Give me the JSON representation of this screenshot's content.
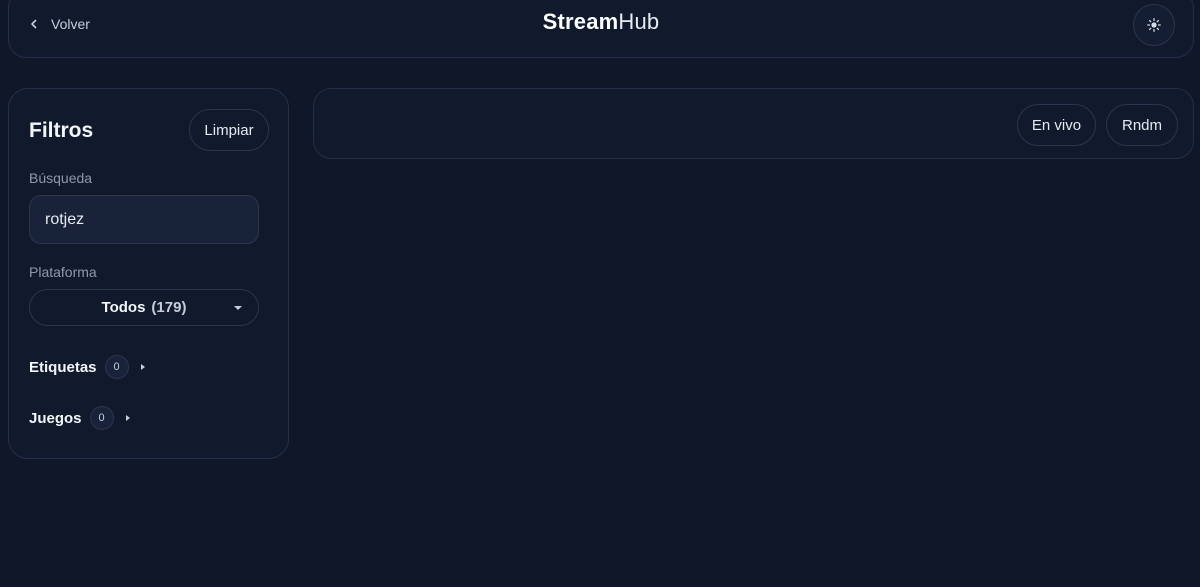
{
  "header": {
    "back_label": "Volver",
    "logo_bold": "Stream",
    "logo_regular": "Hub",
    "theme_icon": "sun-icon"
  },
  "filters": {
    "title": "Filtros",
    "clear_label": "Limpiar",
    "search_label": "Búsqueda",
    "search_value": "rotjez",
    "platform_label": "Plataforma",
    "platform_selected": "Todos",
    "platform_count": "(179)",
    "tags_label": "Etiquetas",
    "tags_count": "0",
    "games_label": "Juegos",
    "games_count": "0"
  },
  "toolbar": {
    "live_label": "En vivo",
    "random_label": "Rndm"
  },
  "colors": {
    "background": "#0f1729",
    "panel": "#111a2d",
    "border": "#243049"
  }
}
